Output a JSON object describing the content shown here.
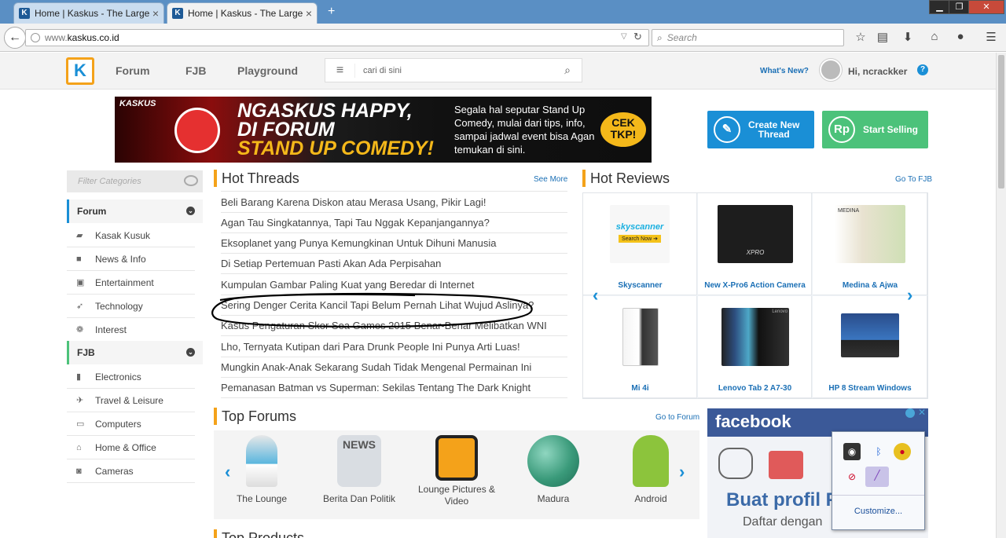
{
  "browser": {
    "tabs": [
      {
        "label": "Home | Kaskus - The Large...",
        "close": "×"
      },
      {
        "label": "Home | Kaskus - The Large...",
        "close": "×"
      }
    ],
    "new_tab": "+",
    "window_buttons": [
      "▁",
      "❐",
      "✕"
    ],
    "url_host": "www.",
    "url_domain": "kaskus.co.id",
    "search_placeholder": "Search",
    "icons": [
      "star-icon",
      "bookmarks-icon",
      "download-icon",
      "home-icon",
      "chat-icon",
      "menu-icon"
    ]
  },
  "site": {
    "logo": "K",
    "nav": [
      "Forum",
      "FJB",
      "Playground"
    ],
    "search_placeholder": "cari di sini",
    "whats_new": "What's New?",
    "greeting": "Hi, ncrackker",
    "help": "?"
  },
  "banner": {
    "brand": "KASKUS",
    "headline_1": "NGASKUS HAPPY,",
    "headline_2": "DI FORUM",
    "headline_3": "STAND UP COMEDY!",
    "description": "Segala hal seputar Stand Up Comedy, mulai dari tips, info, sampai jadwal event bisa Agan temukan di sini.",
    "cta_1": "CEK",
    "cta_2": "TKP!"
  },
  "actions": {
    "create_thread_1": "Create New",
    "create_thread_2": "Thread",
    "start_selling": "Start Selling",
    "sell_icon": "Rp"
  },
  "sidebar": {
    "filter_placeholder": "Filter Categories",
    "forum_header": "Forum",
    "forum_items": [
      "Kasak Kusuk",
      "News & Info",
      "Entertainment",
      "Technology",
      "Interest"
    ],
    "fjb_header": "FJB",
    "fjb_items": [
      "Electronics",
      "Travel & Leisure",
      "Computers",
      "Home & Office",
      "Cameras"
    ]
  },
  "hot_threads": {
    "title": "Hot Threads",
    "link": "See More",
    "items": [
      "Beli Barang Karena Diskon atau Merasa Usang, Pikir Lagi!",
      "Agan Tau Singkatannya, Tapi Tau Nggak Kepanjangannya?",
      "Eksoplanet yang Punya Kemungkinan Untuk Dihuni Manusia",
      "Di Setiap Pertemuan Pasti Akan Ada Perpisahan",
      "Kumpulan Gambar Paling Kuat yang Beredar di Internet",
      "Sering Denger Cerita Kancil Tapi Belum Pernah Lihat Wujud Aslinya?",
      "Kasus Pengaturan Skor Sea Games 2015 Benar-Benar Melibatkan WNI",
      "Lho, Ternyata Kutipan dari Para Drunk People Ini Punya Arti Luas!",
      "Mungkin Anak-Anak Sekarang Sudah Tidak Mengenal Permainan Ini",
      "Pemanasan Batman vs Superman: Sekilas Tentang The Dark Knight"
    ]
  },
  "hot_reviews": {
    "title": "Hot Reviews",
    "link": "Go To FJB",
    "items": [
      {
        "label": "Skyscanner",
        "brand": "skyscanner",
        "sub": "Search Now ➔"
      },
      {
        "label": "New X-Pro6 Action Camera",
        "brand": "XPRO"
      },
      {
        "label": "Medina & Ajwa",
        "brand": "MEDINA"
      },
      {
        "label": "Mi 4i"
      },
      {
        "label": "Lenovo Tab 2 A7-30",
        "brand": "Lenovo"
      },
      {
        "label": "HP 8 Stream Windows"
      }
    ]
  },
  "top_forums": {
    "title": "Top Forums",
    "link": "Go to Forum",
    "items": [
      {
        "label": "The Lounge"
      },
      {
        "label": "Berita Dan Politik",
        "icon_text": "NEWS"
      },
      {
        "label": "Lounge Pictures & Video"
      },
      {
        "label": "Madura"
      },
      {
        "label": "Android"
      }
    ]
  },
  "next_section": {
    "title": "Top Products"
  },
  "facebook": {
    "brand": "facebook",
    "cta": "Buat profil F",
    "sub": "Daftar dengan"
  },
  "tray": {
    "customize": "Customize..."
  },
  "colors": {
    "accent_blue": "#1a8fd6",
    "accent_orange": "#f4a21a",
    "sell_green": "#4cc27a",
    "facebook_blue": "#3b5998"
  }
}
